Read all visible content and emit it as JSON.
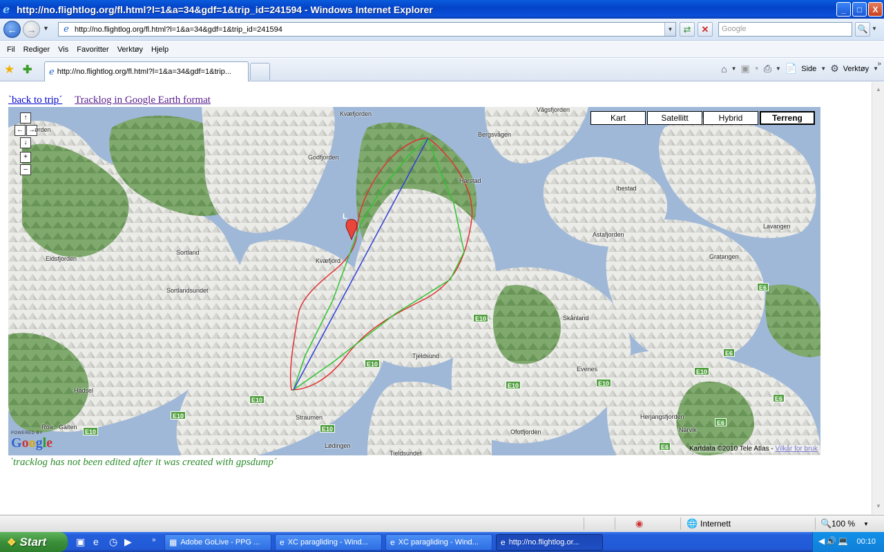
{
  "window": {
    "title": "http://no.flightlog.org/fl.html?l=1&a=34&gdf=1&trip_id=241594 - Windows Internet Explorer",
    "minimize": "_",
    "maximize": "□",
    "close": "X"
  },
  "address": {
    "url": "http://no.flightlog.org/fl.html?l=1&a=34&gdf=1&trip_id=241594",
    "search_placeholder": "Google"
  },
  "menu": [
    "Fil",
    "Rediger",
    "Vis",
    "Favoritter",
    "Verktøy",
    "Hjelp"
  ],
  "tab": {
    "label": "http://no.flightlog.org/fl.html?l=1&a=34&gdf=1&trip..."
  },
  "commandbar": {
    "page_label": "Side",
    "tools_label": "Verktøy"
  },
  "page": {
    "back_link": "`back to trip´",
    "ge_link": "Tracklog in Google Earth format",
    "note": "`tracklog has not been edited after it was created with gpsdump´"
  },
  "map": {
    "types": [
      "Kart",
      "Satellitt",
      "Hybrid",
      "Terreng"
    ],
    "active_type": "Terreng",
    "marker_label": "L",
    "places": [
      {
        "name": "Vågsfjorden"
      },
      {
        "name": "Kvæfjorden"
      },
      {
        "name": "Bergsvågen"
      },
      {
        "name": "Godfjorden"
      },
      {
        "name": "Harstad"
      },
      {
        "name": "Ibestad"
      },
      {
        "name": "Lavangen"
      },
      {
        "name": "Astafjorden"
      },
      {
        "name": "Gratangen"
      },
      {
        "name": "Eidsfjorden"
      },
      {
        "name": "Sortland"
      },
      {
        "name": "Kvæfjord"
      },
      {
        "name": "Sortlandsundet"
      },
      {
        "name": "Skånland"
      },
      {
        "name": "Tjeldsund"
      },
      {
        "name": "Evenes"
      },
      {
        "name": "Hadsel"
      },
      {
        "name": "Straumen"
      },
      {
        "name": "Herjangsfjorden"
      },
      {
        "name": "Roa"
      },
      {
        "name": "Galten"
      },
      {
        "name": "Lødingen"
      },
      {
        "name": "Ofotfjorden"
      },
      {
        "name": "Narvik"
      },
      {
        "name": "Tjeldsundet"
      },
      {
        "name": "ørden"
      }
    ],
    "roads": [
      "E10",
      "E10",
      "E10",
      "E10",
      "E10",
      "E10",
      "E10",
      "E10",
      "E6",
      "E6",
      "E6",
      "E6",
      "E10",
      "E6"
    ],
    "powered_by": "POWERED BY",
    "google_logo": "Google",
    "copyright": "Kartdata ©2010 Tele Atlas -",
    "terms": "Vilkår for bruk",
    "colors": {
      "track_red": "#e03030",
      "track_green": "#2ec42e",
      "track_blue": "#2f3fd8",
      "water": "#9fb8d8",
      "forest": "#7aa86a",
      "land": "#e8e8e4"
    }
  },
  "statusbar": {
    "zone": "Internett",
    "zoom": "100 %"
  },
  "taskbar": {
    "start": "Start",
    "items": [
      "Adobe GoLive - PPG ...",
      "XC paragliding - Wind...",
      "XC paragliding - Wind...",
      "http://no.flightlog.or..."
    ],
    "clock": "00:10"
  }
}
